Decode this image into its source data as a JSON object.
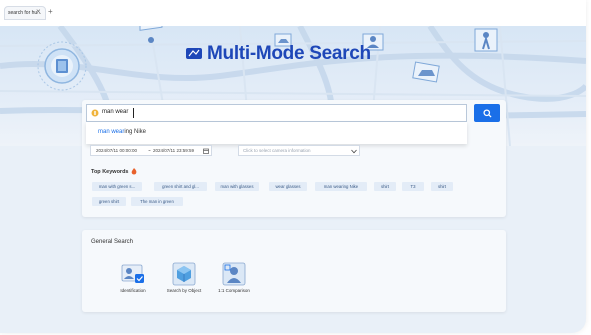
{
  "browser": {
    "tab_title": "search for hu...",
    "close_glyph": "×",
    "new_tab_glyph": "+"
  },
  "hero": {
    "title": "Multi-Mode Search"
  },
  "search": {
    "value": "man wear",
    "icon": "search-mode-icon",
    "button_icon": "search-icon",
    "suggestion_match": "man wear",
    "suggestion_rest": "ing Nike"
  },
  "filters": {
    "date_start": "2024/07/11 00:00:00",
    "date_sep": "~",
    "date_end": "2024/07/11 23:59:59",
    "date_icon": "calendar-icon",
    "select_placeholder": "Click to select camera information",
    "select_icon": "chevron-down-icon"
  },
  "keywords": {
    "label": "Top Keywords",
    "icon": "fire-icon",
    "items": [
      "man with green s...",
      "green shirt and gl...",
      "man with glasses",
      "wear glasses",
      "man wearing Nike",
      "shirt",
      "T3",
      "shirt",
      "green shirt",
      "The man in green"
    ]
  },
  "general": {
    "title": "General Search",
    "items": [
      {
        "label": "Identification",
        "icon": "id-card-icon"
      },
      {
        "label": "Search by Object",
        "icon": "object-cube-icon"
      },
      {
        "label": "1:1 Comparison",
        "icon": "person-compare-icon"
      }
    ]
  },
  "colors": {
    "brand": "#1e47b8",
    "accent": "#1a6fe8",
    "chip_bg": "#e3ecf7"
  }
}
